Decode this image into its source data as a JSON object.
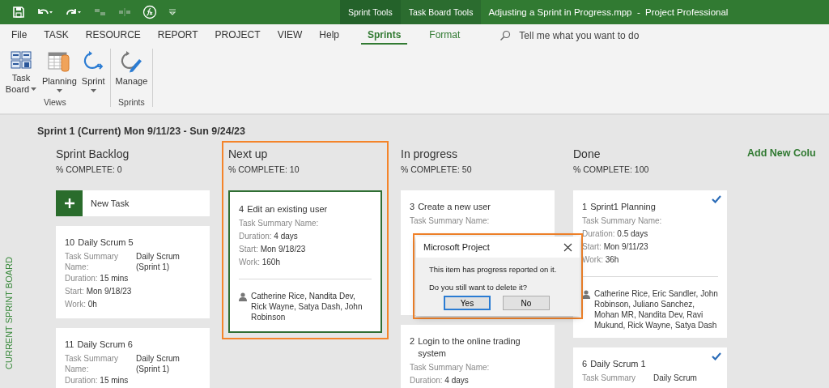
{
  "title_bar": {
    "context_tabs": [
      {
        "label": "Sprint Tools"
      },
      {
        "label": "Task Board Tools"
      }
    ],
    "title": "Adjusting a Sprint in Progress.mpp  -  Project Professional"
  },
  "ribbon_tabs": [
    {
      "label": "File",
      "selected": false,
      "contextual": false
    },
    {
      "label": "TASK",
      "selected": false,
      "contextual": false
    },
    {
      "label": "RESOURCE",
      "selected": false,
      "contextual": false
    },
    {
      "label": "REPORT",
      "selected": false,
      "contextual": false
    },
    {
      "label": "PROJECT",
      "selected": false,
      "contextual": false
    },
    {
      "label": "VIEW",
      "selected": false,
      "contextual": false
    },
    {
      "label": "Help",
      "selected": false,
      "contextual": false
    },
    {
      "label": "Sprints",
      "selected": true,
      "contextual": true
    },
    {
      "label": "Format",
      "selected": false,
      "contextual": true
    }
  ],
  "search": {
    "placeholder": "Tell me what you want to do"
  },
  "ribbon_groups": [
    {
      "label": "Views",
      "commands": [
        {
          "label": "Task Board",
          "dropdown": true,
          "kind": "taskboard"
        },
        {
          "label": "Planning",
          "dropdown": true,
          "kind": "planning"
        },
        {
          "label": "Sprint",
          "dropdown": true,
          "kind": "sprint"
        }
      ]
    },
    {
      "label": "Sprints",
      "commands": [
        {
          "label": "Manage",
          "dropdown": false,
          "kind": "manage"
        }
      ]
    }
  ],
  "board": {
    "side_label": "CURRENT SPRINT BOARD",
    "sprint_heading": "Sprint 1 (Current) Mon 9/11/23 - Sun 9/24/23",
    "add_column": "Add New Colu",
    "columns": [
      {
        "title": "Sprint Backlog",
        "complete": "% COMPLETE: 0",
        "highlighted": false,
        "new_task": "New Task",
        "cards": [
          {
            "number": "10",
            "name": "Daily Scrum 5",
            "summary_label": "Task Summary Name:",
            "summary_value": "Daily Scrum (Sprint 1)",
            "fields": [
              {
                "label": "Duration:",
                "value": "15 mins"
              },
              {
                "label": "Start:",
                "value": "Mon 9/18/23"
              },
              {
                "label": "Work:",
                "value": "0h"
              }
            ],
            "selected": false,
            "done": false,
            "obscured": false
          },
          {
            "number": "11",
            "name": "Daily Scrum 6",
            "summary_label": "Task Summary Name:",
            "summary_value": "Daily Scrum (Sprint 1)",
            "fields": [
              {
                "label": "Duration:",
                "value": "15 mins"
              }
            ],
            "selected": false,
            "done": false,
            "obscured": false
          }
        ]
      },
      {
        "title": "Next up",
        "complete": "% COMPLETE: 10",
        "highlighted": true,
        "cards": [
          {
            "number": "4",
            "name": "Edit an existing user",
            "summary_label": "Task Summary Name:",
            "fields": [
              {
                "label": "Duration:",
                "value": "4 days"
              },
              {
                "label": "Start:",
                "value": "Mon 9/18/23"
              },
              {
                "label": "Work:",
                "value": "160h"
              }
            ],
            "resources": "Catherine Rice, Nandita Dev, Rick Wayne, Satya Dash, John Robinson",
            "selected": true,
            "done": false,
            "obscured": false
          }
        ]
      },
      {
        "title": "In progress",
        "complete": "% COMPLETE: 50",
        "highlighted": false,
        "cards": [
          {
            "number": "3",
            "name": "Create a new user",
            "summary_label": "Task Summary Name:",
            "selected": false,
            "done": false,
            "obscured": true
          },
          {
            "number": "2",
            "name": "Login to the online trading system",
            "summary_label": "Task Summary Name:",
            "fields": [
              {
                "label": "Duration:",
                "value": "4 days"
              }
            ],
            "selected": false,
            "done": false,
            "obscured": false
          }
        ]
      },
      {
        "title": "Done",
        "complete": "% COMPLETE: 100",
        "highlighted": false,
        "cards": [
          {
            "number": "1",
            "name": "Sprint1 Planning",
            "summary_label": "Task Summary Name:",
            "fields": [
              {
                "label": "Duration:",
                "value": "0.5 days"
              },
              {
                "label": "Start:",
                "value": "Mon 9/11/23"
              },
              {
                "label": "Work:",
                "value": "36h"
              }
            ],
            "resources": "Catherine Rice, Eric Sandler, John Robinson, Juliano Sanchez, Mohan MR, Nandita Dev, Ravi Mukund, Rick Wayne, Satya Dash",
            "selected": false,
            "done": true,
            "obscured": false
          },
          {
            "number": "6",
            "name": "Daily Scrum 1",
            "summary_label": "Task Summary",
            "summary_value": "Daily Scrum",
            "selected": false,
            "done": true,
            "obscured": false
          }
        ]
      }
    ]
  },
  "dialog": {
    "title": "Microsoft Project",
    "highlighted": true,
    "messages": [
      "This item has progress reported on it.",
      "Do you still want to delete it?"
    ],
    "buttons": [
      {
        "label": "Yes",
        "default": true
      },
      {
        "label": "No",
        "default": false
      }
    ]
  }
}
